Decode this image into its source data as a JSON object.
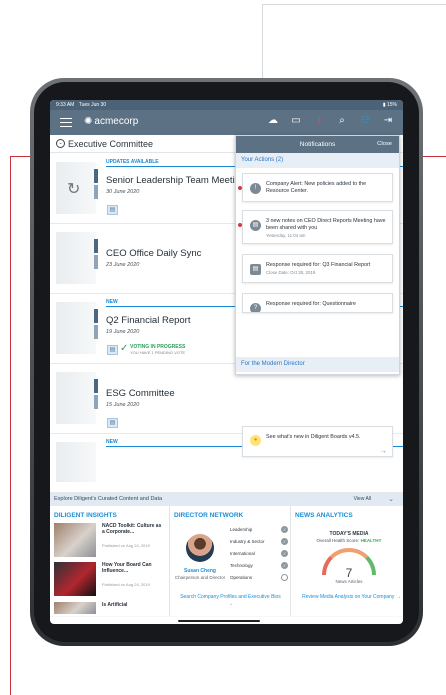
{
  "status": {
    "time": "9:33 AM",
    "date": "Tues Jun 30",
    "battery": "15%"
  },
  "app": {
    "brand": "acmecorp"
  },
  "topbar_icons": [
    "menu-icon",
    "chat-icon",
    "book-icon",
    "bell-icon",
    "search-icon",
    "users-icon",
    "logout-icon"
  ],
  "committee": {
    "title": "Executive Committee"
  },
  "meetings": [
    {
      "badge": "UPDATES AVAILABLE",
      "title": "Senior Leadership Team Meeting",
      "date": "30 June 2020"
    },
    {
      "badge": "",
      "title": "CEO Office Daily Sync",
      "date": "23 June 2020"
    },
    {
      "badge": "NEW",
      "title": "Q2 Financial Report",
      "date": "19 June 2020",
      "vote": "VOTING IN PROGRESS",
      "pending": "YOU HAVE 1 PENDING VOTE"
    },
    {
      "badge": "",
      "title": "ESG Committee",
      "date": "15 June 2020"
    },
    {
      "badge": "NEW",
      "title": "",
      "date": ""
    }
  ],
  "notifications": {
    "title": "Notifications",
    "close": "Close",
    "your_actions": "Your Actions (2)",
    "items": [
      {
        "text": "Company Alert: New policies added to the Resource Center."
      },
      {
        "text": "3 new notes on CEO Direct Reports Meeting have been shared with you",
        "time": "Yesterday, 11:04 am"
      },
      {
        "text": "Response required for: Q3 Financial Report",
        "time": "Close Date: Oct 28, 2019"
      },
      {
        "text": "Response required for: Questionnaire"
      }
    ],
    "modern": "For the Modern Director",
    "modern_item": "See what's new in Diligent Boards v4.5."
  },
  "explore": {
    "title": "Explore Diligent's Curated Content and Data",
    "view_all": "View All"
  },
  "insights": {
    "title": "DILIGENT INSIGHTS",
    "articles": [
      {
        "title": "NACD Toolkit: Culture as a Corporate...",
        "published": "Published on Aug 24, 2019"
      },
      {
        "title": "How Your Board Can Influence...",
        "published": "Published on Aug 24, 2019"
      },
      {
        "title": "Is Artificial",
        "published": ""
      }
    ]
  },
  "director": {
    "title": "DIRECTOR NETWORK",
    "name": "Susan Cheng",
    "role": "Chairperson and Director",
    "skills": [
      "Leadership",
      "Industry & Sector",
      "International",
      "Technology",
      "Operations"
    ],
    "link": "Search Company Profiles and Executive Bios"
  },
  "news": {
    "title": "NEWS ANALYTICS",
    "today": "TODAY'S MEDIA",
    "health_label": "Overall Health Score:",
    "health_value": "HEALTHY",
    "count": "7",
    "count_label": "News Articles",
    "link": "Review Media Analysis on Your Company"
  }
}
